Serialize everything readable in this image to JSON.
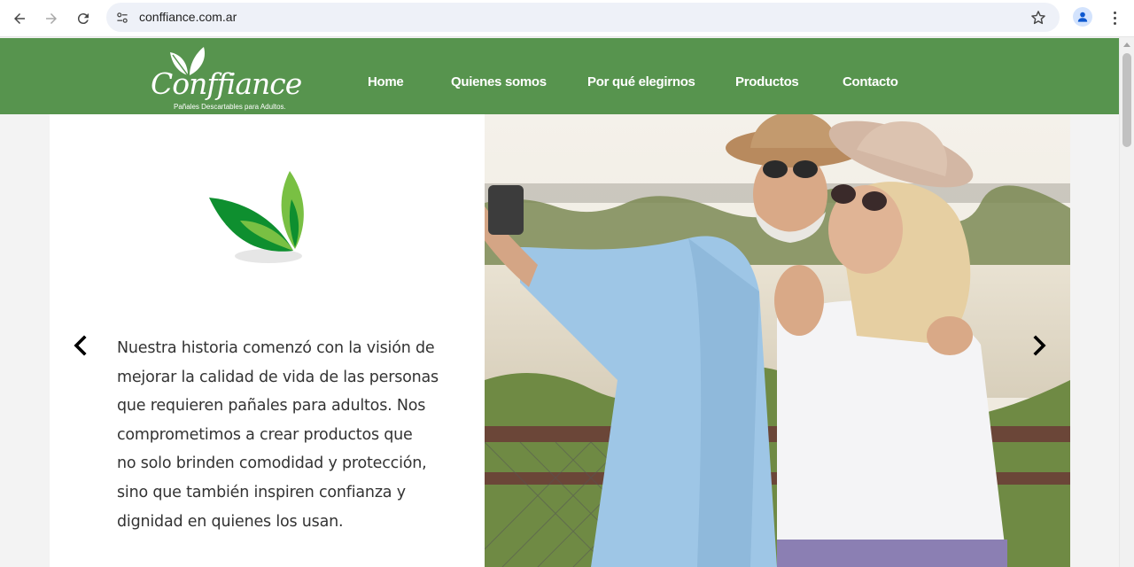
{
  "browser": {
    "url": "conffiance.com.ar",
    "icons": [
      "back-icon",
      "forward-icon",
      "reload-icon",
      "site-settings-icon",
      "bookmark-star-icon",
      "profile-icon",
      "more-menu-icon"
    ]
  },
  "header": {
    "bg_color": "#57944e",
    "logo_text": "Conffiance",
    "logo_tagline": "Pañales Descartables para Adultos.",
    "nav": [
      "Home",
      "Quienes somos",
      "Por qué elegirnos",
      "Productos",
      "Contacto"
    ]
  },
  "hero": {
    "story_lines": [
      "Nuestra historia comenzó con la visión de",
      "mejorar la calidad de vida de las personas",
      "que requieren pañales para adultos. Nos",
      "comprometimos a crear productos que",
      "no solo brinden comodidad y protección,",
      "sino que también inspiren confianza y",
      "dignidad en quienes los usan."
    ],
    "prev_icon": "chevron-left-icon",
    "next_icon": "chevron-right-icon",
    "leaf_colors": [
      "#0e8f2f",
      "#79c043"
    ]
  }
}
